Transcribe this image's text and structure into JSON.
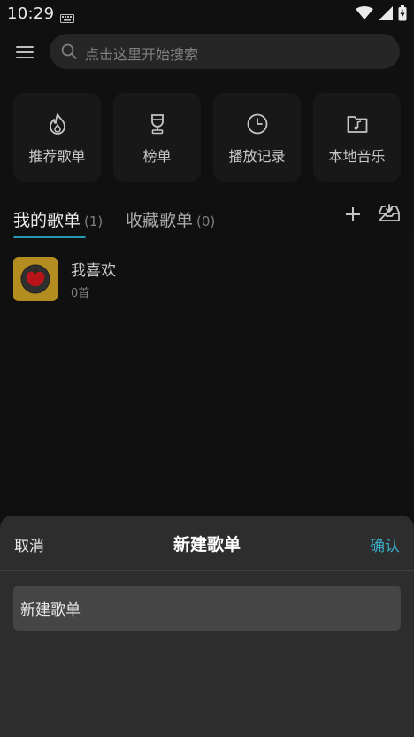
{
  "status_bar": {
    "time": "10:29"
  },
  "search": {
    "placeholder": "点击这里开始搜索"
  },
  "quick_actions": [
    {
      "label": "推荐歌单",
      "icon": "fire-icon"
    },
    {
      "label": "榜单",
      "icon": "trophy-icon"
    },
    {
      "label": "播放记录",
      "icon": "clock-icon"
    },
    {
      "label": "本地音乐",
      "icon": "music-folder-icon"
    }
  ],
  "tabs": [
    {
      "label": "我的歌单",
      "count": "(1)",
      "active": true
    },
    {
      "label": "收藏歌单",
      "count": "(0)",
      "active": false
    }
  ],
  "playlists": [
    {
      "title": "我喜欢",
      "subtitle": "0首"
    }
  ],
  "dialog": {
    "cancel_label": "取消",
    "title": "新建歌单",
    "confirm_label": "确认",
    "input_value": "新建歌单"
  },
  "colors": {
    "accent": "#2aa9c1",
    "background": "#121212",
    "sheet": "#2d2d2d",
    "cover": "#c49a23"
  }
}
